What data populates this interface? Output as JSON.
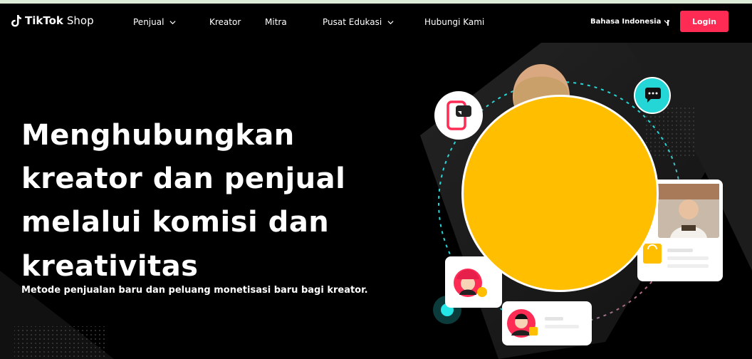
{
  "nav": {
    "logo_brand": "TikTok",
    "logo_product": "Shop",
    "items": [
      {
        "label": "Penjual",
        "has_dropdown": true
      },
      {
        "label": "Kreator",
        "has_dropdown": false
      },
      {
        "label": "Mitra",
        "has_dropdown": false
      },
      {
        "label": "Pusat Edukasi",
        "has_dropdown": true
      },
      {
        "label": "Hubungi Kami",
        "has_dropdown": false
      }
    ],
    "language": "Bahasa Indonesia",
    "login_label": "Login"
  },
  "hero": {
    "headline": [
      "Menghubungkan",
      "kreator dan penjual",
      "melalui komisi dan",
      "kreativitas"
    ],
    "subheadline": "Metode penjualan baru dan peluang monetisasi baru bagi kreator."
  },
  "colors": {
    "background": "#000000",
    "accent": "#fe2c55",
    "highlight": "#ffbf00",
    "teal": "#25d6d6",
    "topline": "#dcebd7"
  },
  "icons": {
    "logo": "tiktok-note-icon",
    "dropdown": "chevron-down-icon",
    "chat": "chat-icon",
    "phone": "phone-icon",
    "shopping_bag": "shopping-bag-icon"
  }
}
